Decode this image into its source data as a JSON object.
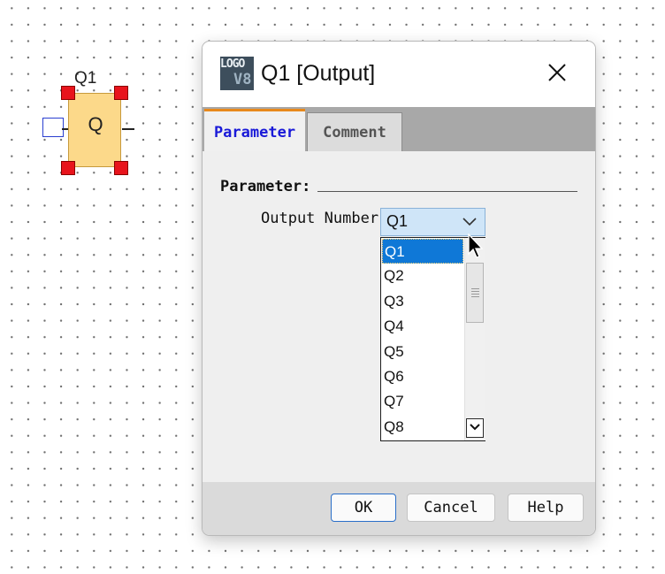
{
  "canvas": {
    "block": {
      "label": "Q1",
      "text": "Q"
    }
  },
  "dialog": {
    "app_icon": {
      "name": "logo-v8-icon",
      "line1": "LOGO",
      "line2": "V8"
    },
    "title": "Q1 [Output]",
    "close_icon": "close-icon",
    "tabs": [
      {
        "label": "Parameter",
        "active": true
      },
      {
        "label": "Comment",
        "active": false
      }
    ],
    "group_label": "Parameter:",
    "output_number": {
      "label": "Output Number:",
      "value": "Q1",
      "options": [
        "Q1",
        "Q2",
        "Q3",
        "Q4",
        "Q5",
        "Q6",
        "Q7",
        "Q8"
      ],
      "selected_index": 0
    },
    "buttons": {
      "ok": "OK",
      "cancel": "Cancel",
      "help": "Help"
    }
  },
  "colors": {
    "selection": "#0f78d7",
    "combo_bg": "#cfe5f8",
    "active_tab_text": "#1a1ad8",
    "tab_accent": "#e8891c",
    "block_fill": "#fcd98a",
    "handle": "#e8141c"
  }
}
